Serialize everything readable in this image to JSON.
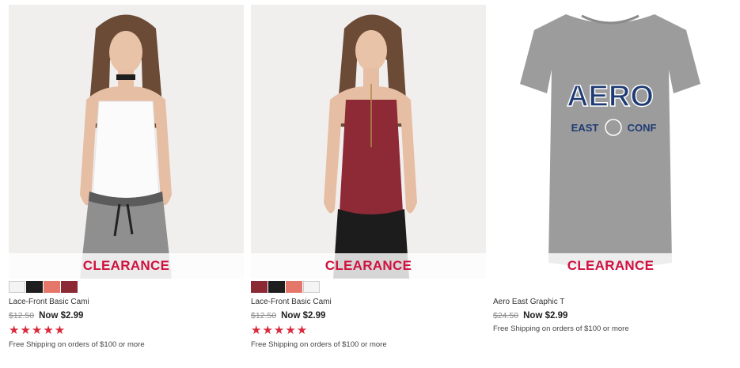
{
  "colors": {
    "accent": "#d0113f",
    "star": "#d9283c"
  },
  "products": [
    {
      "name": "Lace-Front Basic Cami",
      "was_price": "$12.50",
      "now_price": "Now $2.99",
      "banner": "CLEARANCE",
      "rating": "★★★★★",
      "shipping": "Free Shipping on orders of $100 or more",
      "swatches": [
        "#f4f4f4",
        "#1e1e1e",
        "#e5776a",
        "#8b2a34"
      ]
    },
    {
      "name": "Lace-Front Basic Cami",
      "was_price": "$12.50",
      "now_price": "Now $2.99",
      "banner": "CLEARANCE",
      "rating": "★★★★★",
      "shipping": "Free Shipping on orders of $100 or more",
      "swatches": [
        "#8b2a34",
        "#1e1e1e",
        "#e5776a",
        "#f4f4f4"
      ]
    },
    {
      "name": "Aero East Graphic T",
      "was_price": "$24.50",
      "now_price": "Now $2.99",
      "banner": "CLEARANCE",
      "shipping": "Free Shipping on orders of $100 or more",
      "graphic": {
        "line1": "AERO",
        "line2_left": "EAST",
        "line2_right": "CONF"
      }
    }
  ]
}
